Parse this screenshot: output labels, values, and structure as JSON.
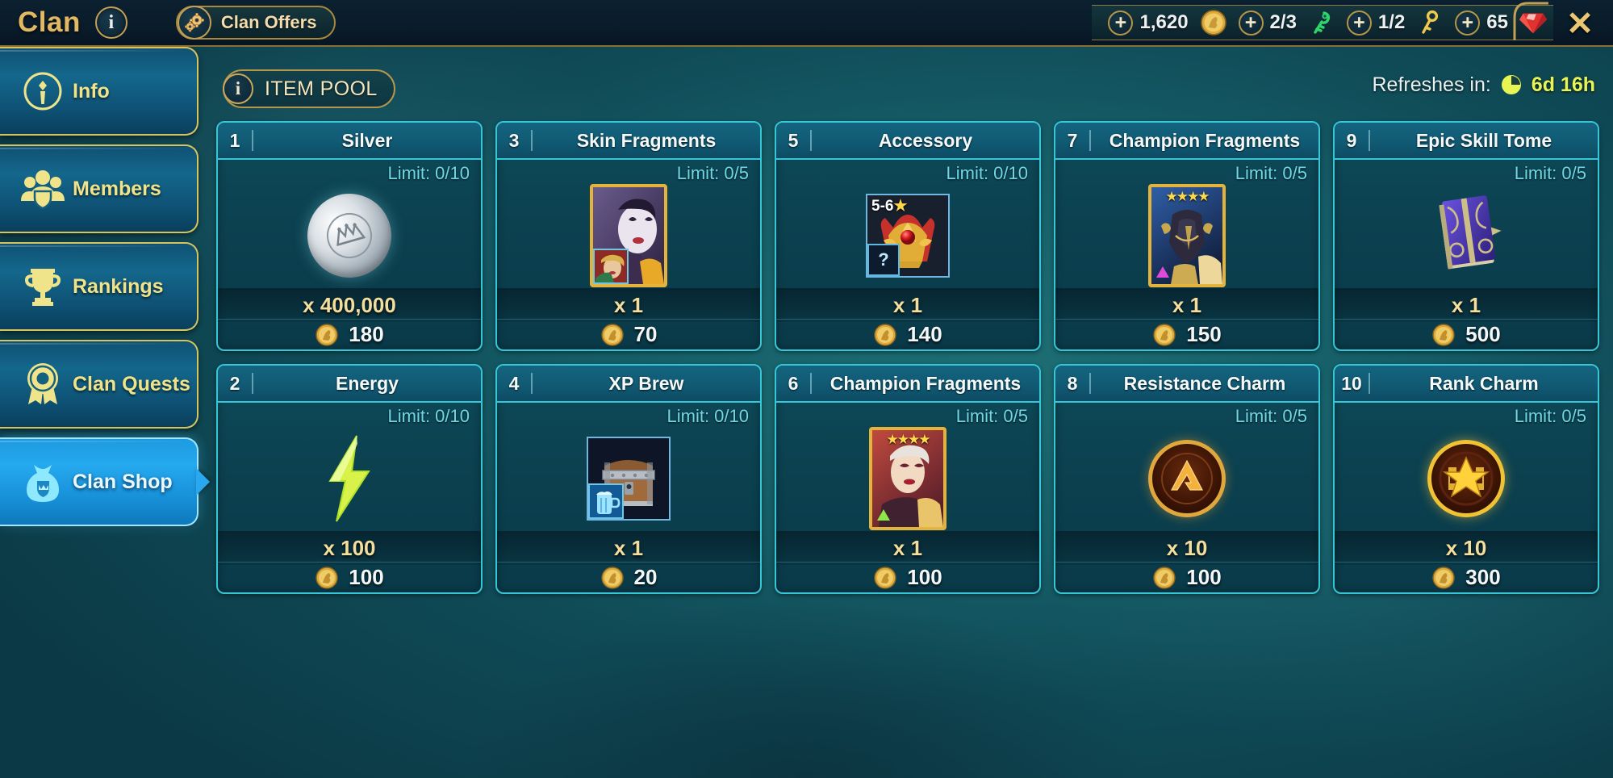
{
  "topbar": {
    "title": "Clan",
    "info_icon": "info-icon",
    "clan_offers_label": "Clan Offers",
    "gear_icon": "gear-icon",
    "close_icon": "close-icon",
    "currencies": [
      {
        "name": "clan-coin",
        "icon": "clan-coin-icon",
        "value": "1,620",
        "plus": "+"
      },
      {
        "name": "clan-key-green",
        "icon": "green-key-icon",
        "value": "2/3",
        "plus": "+"
      },
      {
        "name": "clan-key-gold",
        "icon": "gold-key-icon",
        "value": "1/2",
        "plus": "+"
      },
      {
        "name": "gems",
        "icon": "gem-icon",
        "value": "65",
        "plus": "+"
      }
    ]
  },
  "sidebar": {
    "items": [
      {
        "label": "Info",
        "icon": "info-circle-icon",
        "active": false
      },
      {
        "label": "Members",
        "icon": "members-icon",
        "active": false
      },
      {
        "label": "Rankings",
        "icon": "trophy-icon",
        "active": false
      },
      {
        "label": "Clan Quests",
        "icon": "rosette-icon",
        "active": false
      },
      {
        "label": "Clan Shop",
        "icon": "money-bag-icon",
        "active": true
      }
    ]
  },
  "main": {
    "item_pool_label": "ITEM POOL",
    "item_pool_icon": "info-icon",
    "refresh_label": "Refreshes in:",
    "refresh_icon": "clock-icon",
    "refresh_time": "6d 16h",
    "limit_prefix": "Limit: ",
    "items": [
      {
        "num": "1",
        "name": "Silver",
        "limit": "Limit: 0/10",
        "qty": "x 400,000",
        "price": "180",
        "art": "silver-coin"
      },
      {
        "num": "2",
        "name": "Energy",
        "limit": "Limit: 0/10",
        "qty": "x 100",
        "price": "100",
        "art": "energy-bolt"
      },
      {
        "num": "3",
        "name": "Skin Fragments",
        "limit": "Limit: 0/5",
        "qty": "x 1",
        "price": "70",
        "art": "skin-fragment"
      },
      {
        "num": "4",
        "name": "XP Brew",
        "limit": "Limit: 0/10",
        "qty": "x 1",
        "price": "20",
        "art": "xp-brew-chest"
      },
      {
        "num": "5",
        "name": "Accessory",
        "limit": "Limit: 0/10",
        "qty": "x 1",
        "price": "140",
        "art": "accessory-crown",
        "star_label": "5-6"
      },
      {
        "num": "6",
        "name": "Champion Fragments",
        "limit": "Limit: 0/5",
        "qty": "x 1",
        "price": "100",
        "art": "champion-red",
        "stars": "★★★★"
      },
      {
        "num": "7",
        "name": "Champion Fragments",
        "limit": "Limit: 0/5",
        "qty": "x 1",
        "price": "150",
        "art": "champion-blue",
        "stars": "★★★★"
      },
      {
        "num": "8",
        "name": "Resistance Charm",
        "limit": "Limit: 0/5",
        "qty": "x 10",
        "price": "100",
        "art": "resistance-charm"
      },
      {
        "num": "9",
        "name": "Epic Skill Tome",
        "limit": "Limit: 0/5",
        "qty": "x 1",
        "price": "500",
        "art": "epic-tome"
      },
      {
        "num": "10",
        "name": "Rank Charm",
        "limit": "Limit: 0/5",
        "qty": "x 10",
        "price": "300",
        "art": "rank-charm"
      }
    ]
  },
  "colors": {
    "gold": "#e3b863",
    "card_border": "#35c6d8",
    "limit_text": "#6fd8e4",
    "qty_text": "#f3de9e",
    "active_nav": "#25a9ef",
    "refresh_time": "#e8f453"
  }
}
